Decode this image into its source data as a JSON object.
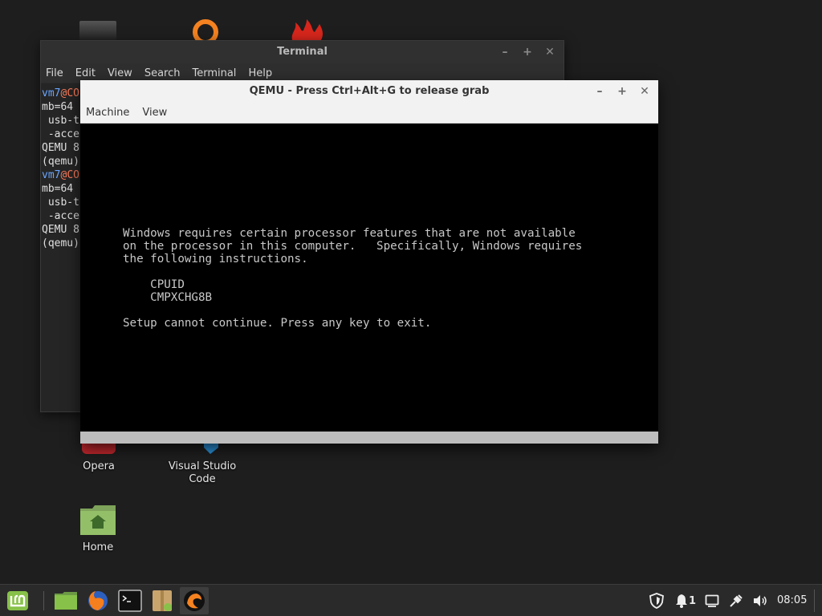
{
  "desktop": {
    "icons": [
      {
        "label": "Opera"
      },
      {
        "label_line1": "Visual Studio",
        "label_line2": "Code"
      },
      {
        "label": "Home"
      }
    ]
  },
  "terminal": {
    "title": "Terminal",
    "menu": [
      "File",
      "Edit",
      "View",
      "Search",
      "Terminal",
      "Help"
    ],
    "lines": [
      {
        "user": "vm7",
        "at": "@",
        "host": "CO"
      },
      {
        "text": "mb=64"
      },
      {
        "text": " usb-t"
      },
      {
        "text": " -acce"
      },
      {
        "text": "QEMU 8"
      },
      {
        "text": "(qemu)"
      },
      {
        "user": "vm7",
        "at": "@",
        "host": "CO"
      },
      {
        "text": "mb=64"
      },
      {
        "text": " usb-t"
      },
      {
        "text": " -acce"
      },
      {
        "text": "QEMU 8"
      },
      {
        "text": "(qemu)"
      }
    ],
    "controls": {
      "minimize": "–",
      "maximize": "+",
      "close": "✕"
    }
  },
  "qemu": {
    "title": "QEMU - Press Ctrl+Alt+G to release grab",
    "menu": [
      "Machine",
      "View"
    ],
    "controls": {
      "minimize": "–",
      "maximize": "+",
      "close": "✕"
    },
    "screen": {
      "line1": "Windows requires certain processor features that are not available",
      "line2": "on the processor in this computer.   Specifically, Windows requires",
      "line3": "the following instructions.",
      "instr1": "    CPUID",
      "instr2": "    CMPXCHG8B",
      "line4": "Setup cannot continue. Press any key to exit."
    }
  },
  "taskbar": {
    "items": [
      "mint-menu-icon",
      "files-icon",
      "firefox-icon",
      "terminal-icon",
      "archive-manager-icon",
      "qemu-icon"
    ],
    "tray": {
      "notification_count": "1"
    },
    "clock": "08:05"
  },
  "colors": {
    "desktop_bg": "#1e1e1e",
    "mint_green": "#87c149",
    "terminal_bg": "#252525",
    "qemu_screen": "#000000",
    "accent_orange": "#f58220"
  }
}
